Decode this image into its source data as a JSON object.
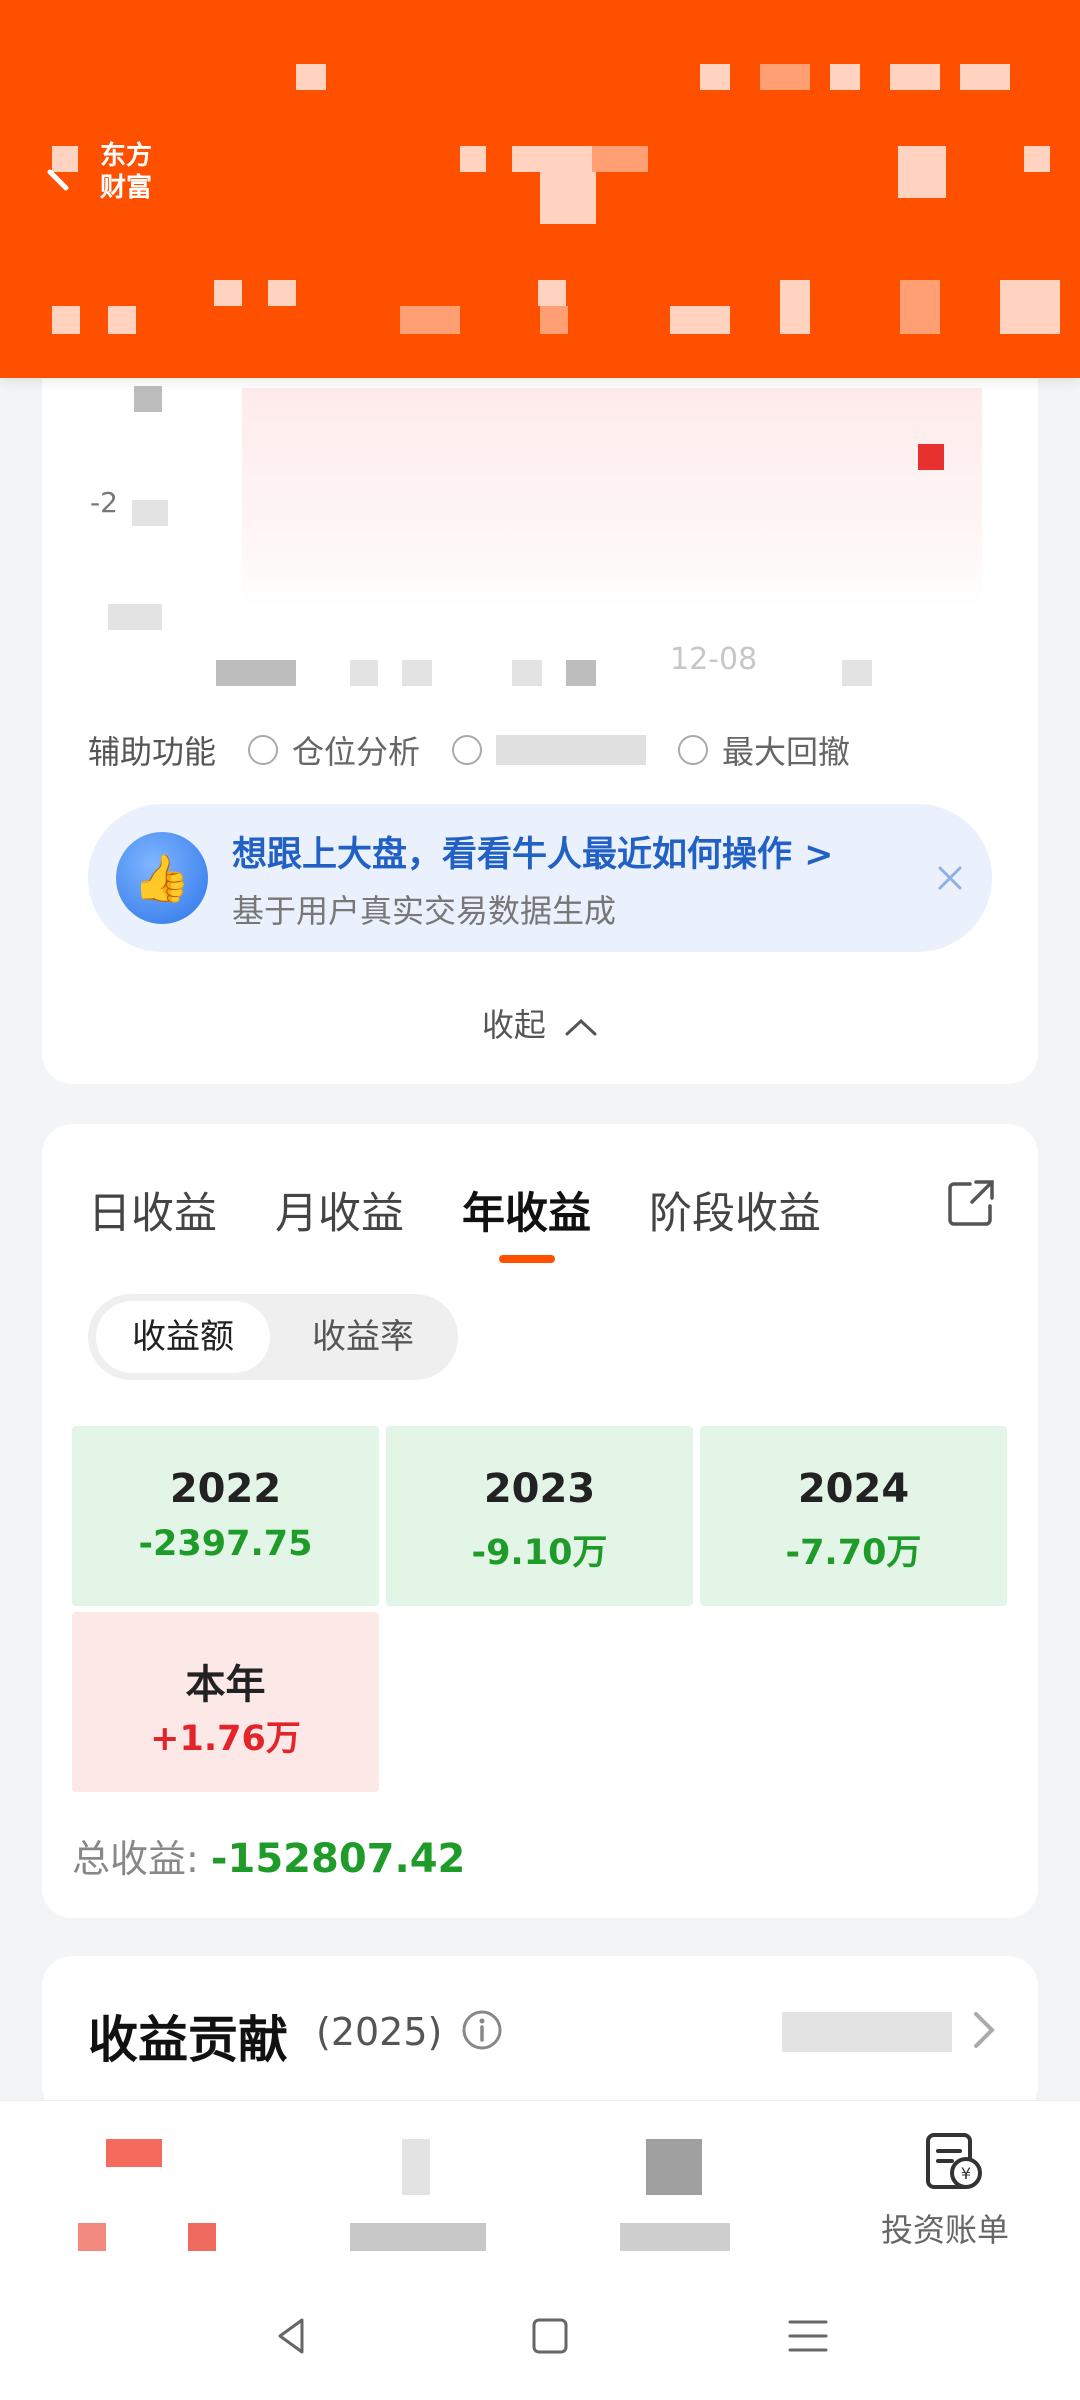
{
  "header": {
    "brand_line1": "东方",
    "brand_line2": "财富"
  },
  "chart": {
    "y_label": "-2",
    "x_label_partial": "12-08"
  },
  "aux": {
    "label": "辅助功能",
    "options": [
      "仓位分析",
      "",
      "最大回撤"
    ]
  },
  "promo": {
    "title": "想跟上大盘，看看牛人最近如何操作 >",
    "subtitle": "基于用户真实交易数据生成"
  },
  "collapse_label": "收起",
  "earnings": {
    "tabs": [
      "日收益",
      "月收益",
      "年收益",
      "阶段收益"
    ],
    "active_tab": "年收益",
    "segment": [
      "收益额",
      "收益率"
    ],
    "years": [
      {
        "year": "2022",
        "value": "-2397.75",
        "type": "loss"
      },
      {
        "year": "2023",
        "value": "-9.10万",
        "type": "loss"
      },
      {
        "year": "2024",
        "value": "-7.70万",
        "type": "loss"
      },
      {
        "year": "本年",
        "value": "+1.76万",
        "type": "gain"
      }
    ],
    "total_label": "总收益:",
    "total_value": "-152807.42"
  },
  "contribution": {
    "title": "收益贡献",
    "year": "(2025)",
    "more": "查看更多"
  },
  "bottom_nav": {
    "bill_label": "投资账单"
  },
  "colors": {
    "brand": "#ff5000",
    "loss": "#1f9b2a",
    "gain": "#e2252a",
    "promo_text": "#2160c4"
  }
}
